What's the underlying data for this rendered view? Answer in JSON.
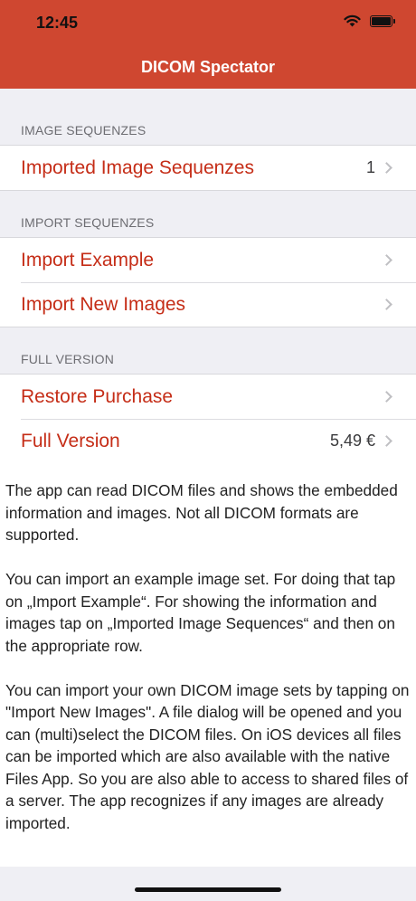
{
  "status_bar": {
    "time": "12:45"
  },
  "nav": {
    "title": "DICOM Spectator"
  },
  "sections": [
    {
      "header": "IMAGE SEQUENZES",
      "rows": [
        {
          "label": "Imported Image Sequenzes",
          "detail": "1"
        }
      ]
    },
    {
      "header": "IMPORT SEQUENZES",
      "rows": [
        {
          "label": "Import Example"
        },
        {
          "label": "Import New Images"
        }
      ]
    },
    {
      "header": "FULL VERSION",
      "rows": [
        {
          "label": "Restore Purchase"
        },
        {
          "label": "Full Version",
          "detail": "5,49 €"
        }
      ]
    }
  ],
  "info": {
    "paragraphs": [
      "The app can read DICOM files and shows the embedded information and images. Not all DICOM formats are supported.",
      "You can import an example image set. For doing that tap on „Import Example“. For showing the information and images tap on „Imported Image Sequences“ and then on the appropriate row.",
      "You can import your own DICOM image sets by tapping on \"Import New Images\". A file dialog will be opened and you can (multi)select the DICOM files. On iOS devices all files can be imported which are also available with the native Files App. So you are also able to access to shared files of a server. The app recognizes if any images are already imported."
    ]
  },
  "colors": {
    "nav_bar": "#cf4730",
    "accent_text": "#c52d17",
    "background": "#efeff4"
  }
}
